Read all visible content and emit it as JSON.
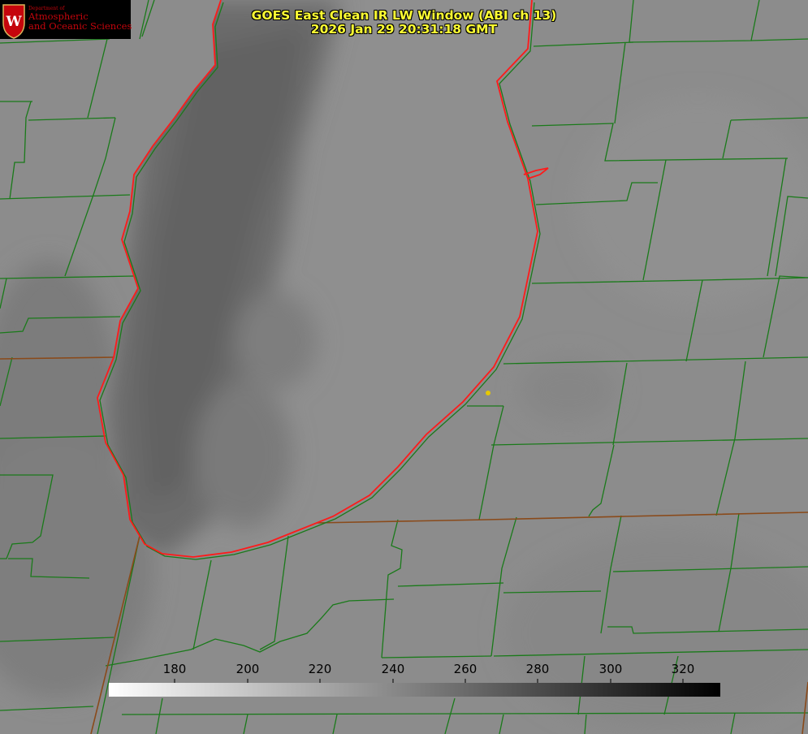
{
  "header": {
    "title_line1": "GOES East Clean IR LW Window (ABI ch 13)",
    "title_line2": "2026 Jan 29 20:31:18 GMT"
  },
  "logo": {
    "department": "Department of",
    "line1": "Atmospheric",
    "line2": "and Oceanic Sciences",
    "emblem_letter": "W"
  },
  "colorbar": {
    "ticks": [
      "180",
      "200",
      "220",
      "240",
      "260",
      "280",
      "300",
      "320"
    ],
    "gradient_from": "#ffffff",
    "gradient_to": "#000000"
  },
  "colors": {
    "background": "#8c8c8c",
    "county_lines": "#1a7a1a",
    "state_lines": "#8a4a1a",
    "lake_outline": "#ff1a1a",
    "title_text": "#ffff33",
    "station_marker": "#e6c800"
  }
}
